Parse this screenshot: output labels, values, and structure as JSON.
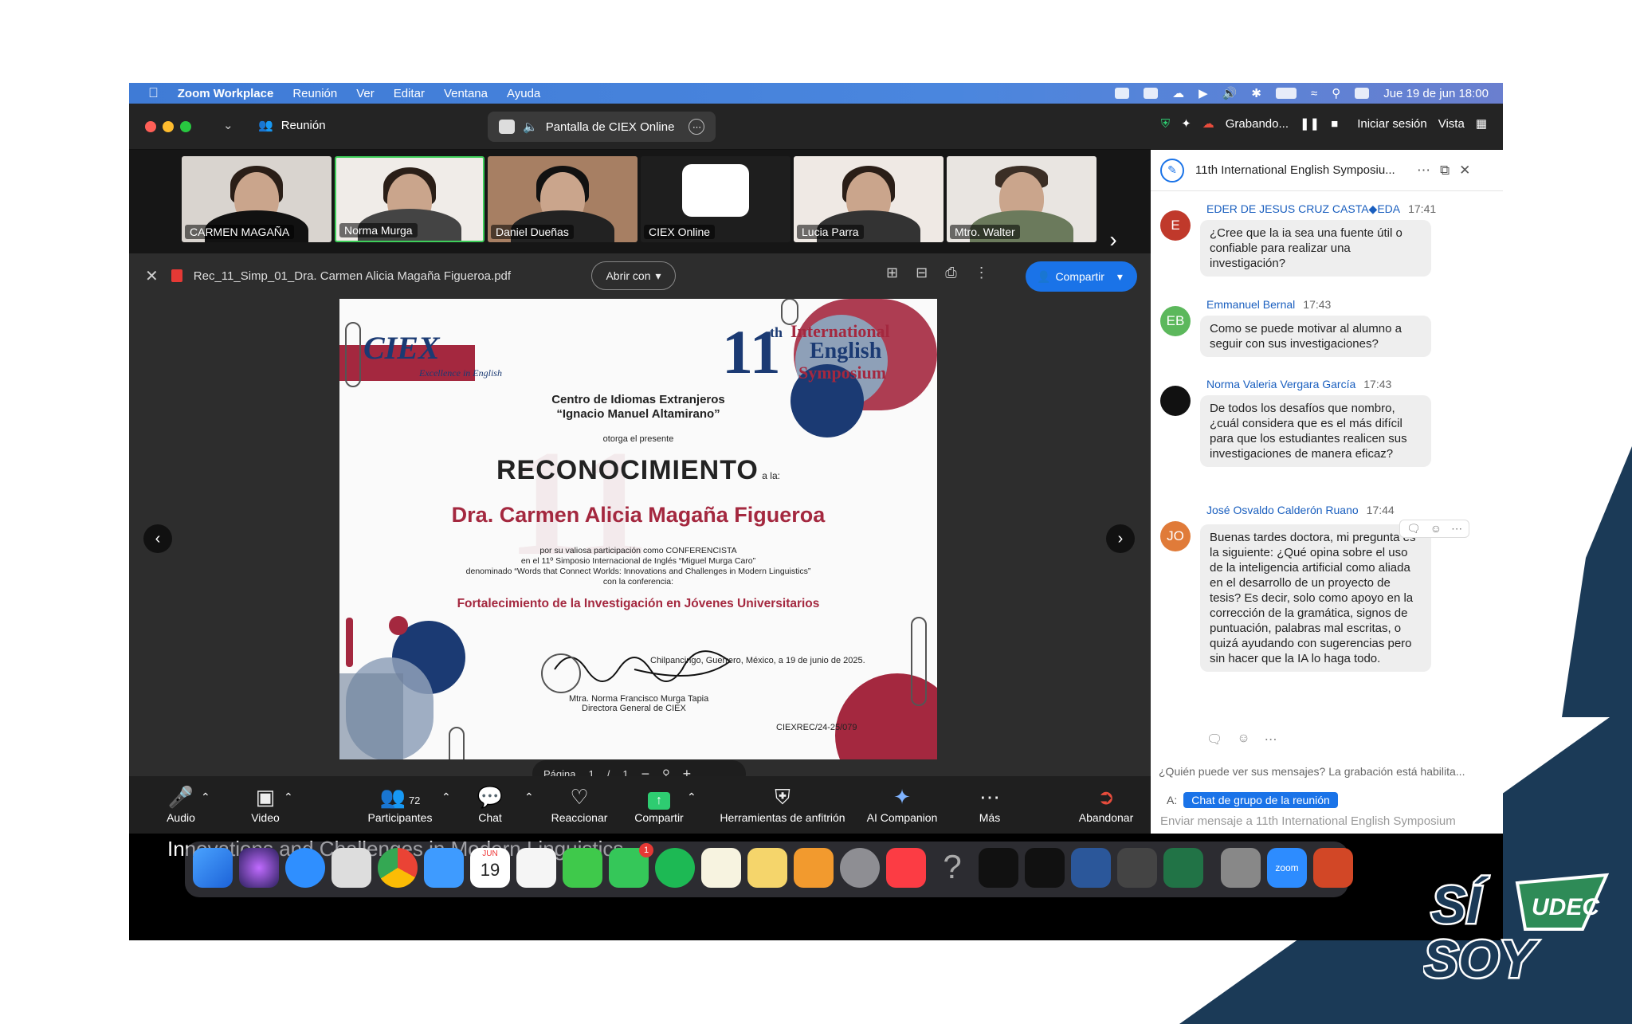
{
  "menubar": {
    "app": "Zoom Workplace",
    "items": [
      "Reunión",
      "Ver",
      "Editar",
      "Ventana",
      "Ayuda"
    ],
    "datetime": "Jue 19 de jun  18:00"
  },
  "titlebar": {
    "meeting_label": "Reunión",
    "share_label": "Pantalla de CIEX Online",
    "recording": "Grabando...",
    "signin": "Iniciar sesión",
    "view": "Vista"
  },
  "participants": [
    {
      "name": "CARMEN MAGAÑA"
    },
    {
      "name": "Norma Murga"
    },
    {
      "name": "Daniel Dueñas"
    },
    {
      "name": "CIEX Online"
    },
    {
      "name": "Lucia Parra"
    },
    {
      "name": "Mtro. Walter"
    }
  ],
  "pdf_viewer": {
    "filename": "Rec_11_Simp_01_Dra. Carmen Alicia Magaña Figueroa.pdf",
    "open_with": "Abrir con",
    "share_button": "Compartir",
    "page_label": "Página",
    "page_current": "1",
    "page_sep": "/",
    "page_total": "1"
  },
  "certificate": {
    "logo_text": "CIEX",
    "logo_tagline": "Excellence in English",
    "badge_number": "11",
    "badge_th": "th",
    "badge_line1": "International",
    "badge_line2": "English",
    "badge_line3": "Symposium",
    "center_line1": "Centro de Idiomas Extranjeros",
    "center_line2": "“Ignacio Manuel Altamirano”",
    "otorga": "otorga el presente",
    "title": "RECONOCIMIENTO",
    "title_suffix": "a la:",
    "recipient": "Dra. Carmen Alicia Magaña Figueroa",
    "body1": "por su valiosa participación como CONFERENCISTA",
    "body2": "en el 11º Simposio Internacional de Inglés “Miguel Murga Caro”",
    "body3": "denominado “Words that Connect Worlds: Innovations and Challenges in Modern Linguistics”",
    "body4": "con la conferencia:",
    "conference": "Fortalecimiento de la Investigación en Jóvenes Universitarios",
    "place_date": "Chilpancingo, Guerrero, México, a 19 de junio de 2025.",
    "signer": "Mtra. Norma Francisco Murga Tapia",
    "signer_role": "Directora General de CIEX",
    "code": "CIEXREC/24-25/079"
  },
  "toolbar": {
    "audio": "Audio",
    "video": "Video",
    "participants": "Participantes",
    "participants_count": "72",
    "chat": "Chat",
    "react": "Reaccionar",
    "share": "Compartir",
    "host_tools": "Herramientas de anfitrión",
    "companion": "AI Companion",
    "more": "Más",
    "leave": "Abandonar"
  },
  "chat": {
    "title": "11th International English Symposiu...",
    "messages": [
      {
        "author": "EDER DE JESUS CRUZ CASTA◆EDA",
        "time": "17:41",
        "initials": "E",
        "text": "¿Cree que la ia sea una fuente útil o confiable para realizar una investigación?"
      },
      {
        "author": "Emmanuel Bernal",
        "time": "17:43",
        "initials": "EB",
        "text": "Como se puede motivar al alumno a seguir con sus investigaciones?"
      },
      {
        "author": "Norma Valeria Vergara García",
        "time": "17:43",
        "initials": "",
        "text": "De todos los desafíos que nombro, ¿cuál considera que es el más difícil para que los estudiantes realicen sus investigaciones de manera eficaz?"
      },
      {
        "author": "José Osvaldo Calderón Ruano",
        "time": "17:44",
        "initials": "JO",
        "text": "Buenas tardes doctora, mi pregunta es la siguiente: ¿Qué opina sobre el uso de la inteligencia artificial como aliada en el desarrollo de un proyecto de tesis? Es decir, solo como apoyo en la corrección de la gramática, signos de puntuación, palabras mal escritas, o quizá ayudando con sugerencias pero sin hacer que la IA lo haga todo."
      }
    ],
    "note": "¿Quién puede ver sus mensajes? La grabación está habilita...",
    "to_label": "A:",
    "to_value": "Chat de grupo de la reunión",
    "input_placeholder": "Enviar mensaje a 11th International English Symposium"
  },
  "dock": {
    "calendar_month": "JUN",
    "calendar_day": "19",
    "zoom_label": "zoom",
    "badge": "1"
  },
  "background_caption": "Innovations and Challenges in Modern Linguistics",
  "brand": {
    "line1": "SÍ",
    "line2": "SOY",
    "tag": "UDEC"
  },
  "colors": {
    "navy": "#1b3a57",
    "maroon": "#a4283f",
    "zoom_blue": "#1a73e8",
    "green": "#4caf50"
  }
}
